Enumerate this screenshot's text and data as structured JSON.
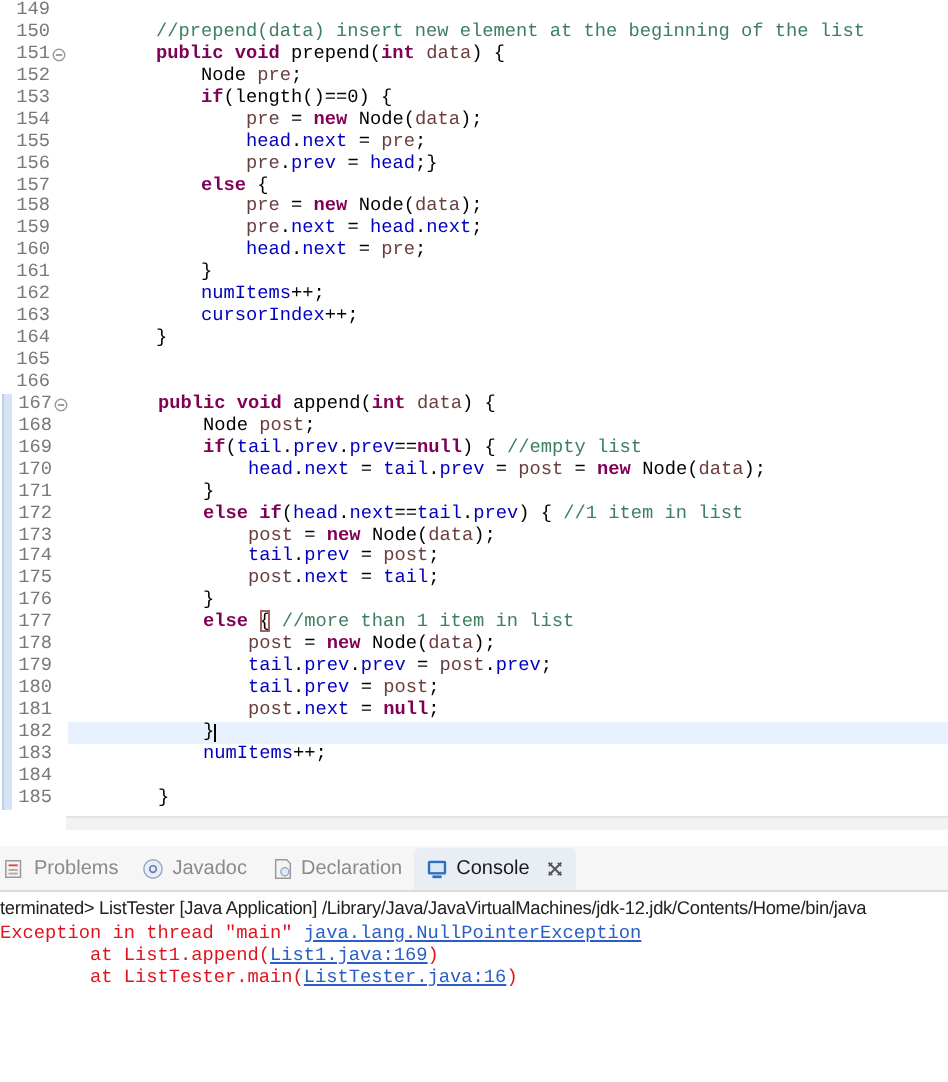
{
  "editor": {
    "lines": [
      {
        "number": "149",
        "fold": false,
        "changed": false,
        "current": false,
        "cursor": false
      },
      {
        "number": "150",
        "fold": false,
        "changed": false,
        "current": false,
        "cursor": false,
        "tokens": [
          {
            "kind": "comment",
            "text": "        //prepend(data) insert new element at the beginning of the list"
          }
        ]
      },
      {
        "number": "151",
        "fold": true,
        "changed": false,
        "current": false,
        "cursor": false,
        "tokens": [
          {
            "kind": "keyword",
            "text": "        public void "
          },
          {
            "kind": "plain",
            "text": "prepend("
          },
          {
            "kind": "keyword",
            "text": "int "
          },
          {
            "kind": "local",
            "text": "data"
          },
          {
            "kind": "plain",
            "text": ") {"
          }
        ]
      },
      {
        "number": "152",
        "fold": false,
        "changed": false,
        "current": false,
        "cursor": false,
        "tokens": [
          {
            "kind": "plain",
            "text": "            Node "
          },
          {
            "kind": "local",
            "text": "pre"
          },
          {
            "kind": "plain",
            "text": ";"
          }
        ]
      },
      {
        "number": "153",
        "fold": false,
        "changed": false,
        "current": false,
        "cursor": false,
        "tokens": [
          {
            "kind": "keyword",
            "text": "            if"
          },
          {
            "kind": "plain",
            "text": "(length()==0) {"
          }
        ]
      },
      {
        "number": "154",
        "fold": false,
        "changed": false,
        "current": false,
        "cursor": false,
        "tokens": [
          {
            "kind": "local",
            "text": "                pre"
          },
          {
            "kind": "plain",
            "text": " = "
          },
          {
            "kind": "keyword",
            "text": "new"
          },
          {
            "kind": "plain",
            "text": " Node("
          },
          {
            "kind": "local",
            "text": "data"
          },
          {
            "kind": "plain",
            "text": ");"
          }
        ]
      },
      {
        "number": "155",
        "fold": false,
        "changed": false,
        "current": false,
        "cursor": false,
        "tokens": [
          {
            "kind": "field",
            "text": "                head"
          },
          {
            "kind": "plain",
            "text": "."
          },
          {
            "kind": "field",
            "text": "next"
          },
          {
            "kind": "plain",
            "text": " = "
          },
          {
            "kind": "local",
            "text": "pre"
          },
          {
            "kind": "plain",
            "text": ";"
          }
        ]
      },
      {
        "number": "156",
        "fold": false,
        "changed": false,
        "current": false,
        "cursor": false,
        "tokens": [
          {
            "kind": "local",
            "text": "                pre"
          },
          {
            "kind": "plain",
            "text": "."
          },
          {
            "kind": "field",
            "text": "prev"
          },
          {
            "kind": "plain",
            "text": " = "
          },
          {
            "kind": "field",
            "text": "head"
          },
          {
            "kind": "plain",
            "text": ";}"
          }
        ]
      },
      {
        "number": "157",
        "fold": false,
        "changed": false,
        "current": false,
        "cursor": false,
        "tokens": [
          {
            "kind": "keyword",
            "text": "            else"
          },
          {
            "kind": "plain",
            "text": " {"
          }
        ]
      },
      {
        "number": "158",
        "fold": false,
        "changed": false,
        "current": false,
        "cursor": false,
        "tokens": [
          {
            "kind": "local",
            "text": "                pre"
          },
          {
            "kind": "plain",
            "text": " = "
          },
          {
            "kind": "keyword",
            "text": "new"
          },
          {
            "kind": "plain",
            "text": " Node("
          },
          {
            "kind": "local",
            "text": "data"
          },
          {
            "kind": "plain",
            "text": ");"
          }
        ]
      },
      {
        "number": "159",
        "fold": false,
        "changed": false,
        "current": false,
        "cursor": false,
        "tokens": [
          {
            "kind": "local",
            "text": "                pre"
          },
          {
            "kind": "plain",
            "text": "."
          },
          {
            "kind": "field",
            "text": "next"
          },
          {
            "kind": "plain",
            "text": " = "
          },
          {
            "kind": "field",
            "text": "head"
          },
          {
            "kind": "plain",
            "text": "."
          },
          {
            "kind": "field",
            "text": "next"
          },
          {
            "kind": "plain",
            "text": ";"
          }
        ]
      },
      {
        "number": "160",
        "fold": false,
        "changed": false,
        "current": false,
        "cursor": false,
        "tokens": [
          {
            "kind": "field",
            "text": "                head"
          },
          {
            "kind": "plain",
            "text": "."
          },
          {
            "kind": "field",
            "text": "next"
          },
          {
            "kind": "plain",
            "text": " = "
          },
          {
            "kind": "local",
            "text": "pre"
          },
          {
            "kind": "plain",
            "text": ";"
          }
        ]
      },
      {
        "number": "161",
        "fold": false,
        "changed": false,
        "current": false,
        "cursor": false,
        "tokens": [
          {
            "kind": "plain",
            "text": "            }"
          }
        ]
      },
      {
        "number": "162",
        "fold": false,
        "changed": false,
        "current": false,
        "cursor": false,
        "tokens": [
          {
            "kind": "field",
            "text": "            numItems"
          },
          {
            "kind": "plain",
            "text": "++;"
          }
        ]
      },
      {
        "number": "163",
        "fold": false,
        "changed": false,
        "current": false,
        "cursor": false,
        "tokens": [
          {
            "kind": "field",
            "text": "            cursorIndex"
          },
          {
            "kind": "plain",
            "text": "++;"
          }
        ]
      },
      {
        "number": "164",
        "fold": false,
        "changed": false,
        "current": false,
        "cursor": false,
        "tokens": [
          {
            "kind": "plain",
            "text": "        }"
          }
        ]
      },
      {
        "number": "165",
        "fold": false,
        "changed": false,
        "current": false,
        "cursor": false
      },
      {
        "number": "166",
        "fold": false,
        "changed": false,
        "current": false,
        "cursor": false
      },
      {
        "number": "167",
        "fold": true,
        "changed": true,
        "current": false,
        "cursor": false,
        "tokens": [
          {
            "kind": "keyword",
            "text": "        public void "
          },
          {
            "kind": "plain",
            "text": "append("
          },
          {
            "kind": "keyword",
            "text": "int "
          },
          {
            "kind": "local",
            "text": "data"
          },
          {
            "kind": "plain",
            "text": ") {"
          }
        ]
      },
      {
        "number": "168",
        "fold": false,
        "changed": true,
        "current": false,
        "cursor": false,
        "tokens": [
          {
            "kind": "plain",
            "text": "            Node "
          },
          {
            "kind": "local",
            "text": "post"
          },
          {
            "kind": "plain",
            "text": ";"
          }
        ]
      },
      {
        "number": "169",
        "fold": false,
        "changed": true,
        "current": false,
        "cursor": false,
        "tokens": [
          {
            "kind": "keyword",
            "text": "            if"
          },
          {
            "kind": "plain",
            "text": "("
          },
          {
            "kind": "field",
            "text": "tail"
          },
          {
            "kind": "plain",
            "text": "."
          },
          {
            "kind": "field",
            "text": "prev"
          },
          {
            "kind": "plain",
            "text": "."
          },
          {
            "kind": "field",
            "text": "prev"
          },
          {
            "kind": "plain",
            "text": "=="
          },
          {
            "kind": "keyword",
            "text": "null"
          },
          {
            "kind": "plain",
            "text": ") { "
          },
          {
            "kind": "comment",
            "text": "//empty list"
          }
        ]
      },
      {
        "number": "170",
        "fold": false,
        "changed": true,
        "current": false,
        "cursor": false,
        "tokens": [
          {
            "kind": "field",
            "text": "                head"
          },
          {
            "kind": "plain",
            "text": "."
          },
          {
            "kind": "field",
            "text": "next"
          },
          {
            "kind": "plain",
            "text": " = "
          },
          {
            "kind": "field",
            "text": "tail"
          },
          {
            "kind": "plain",
            "text": "."
          },
          {
            "kind": "field",
            "text": "prev"
          },
          {
            "kind": "plain",
            "text": " = "
          },
          {
            "kind": "local",
            "text": "post"
          },
          {
            "kind": "plain",
            "text": " = "
          },
          {
            "kind": "keyword",
            "text": "new"
          },
          {
            "kind": "plain",
            "text": " Node("
          },
          {
            "kind": "local",
            "text": "data"
          },
          {
            "kind": "plain",
            "text": ");"
          }
        ]
      },
      {
        "number": "171",
        "fold": false,
        "changed": true,
        "current": false,
        "cursor": false,
        "tokens": [
          {
            "kind": "plain",
            "text": "            }"
          }
        ]
      },
      {
        "number": "172",
        "fold": false,
        "changed": true,
        "current": false,
        "cursor": false,
        "tokens": [
          {
            "kind": "keyword",
            "text": "            else if"
          },
          {
            "kind": "plain",
            "text": "("
          },
          {
            "kind": "field",
            "text": "head"
          },
          {
            "kind": "plain",
            "text": "."
          },
          {
            "kind": "field",
            "text": "next"
          },
          {
            "kind": "plain",
            "text": "=="
          },
          {
            "kind": "field",
            "text": "tail"
          },
          {
            "kind": "plain",
            "text": "."
          },
          {
            "kind": "field",
            "text": "prev"
          },
          {
            "kind": "plain",
            "text": ") { "
          },
          {
            "kind": "comment",
            "text": "//1 item in list"
          }
        ]
      },
      {
        "number": "173",
        "fold": false,
        "changed": true,
        "current": false,
        "cursor": false,
        "tokens": [
          {
            "kind": "local",
            "text": "                post"
          },
          {
            "kind": "plain",
            "text": " = "
          },
          {
            "kind": "keyword",
            "text": "new"
          },
          {
            "kind": "plain",
            "text": " Node("
          },
          {
            "kind": "local",
            "text": "data"
          },
          {
            "kind": "plain",
            "text": ");"
          }
        ]
      },
      {
        "number": "174",
        "fold": false,
        "changed": true,
        "current": false,
        "cursor": false,
        "tokens": [
          {
            "kind": "field",
            "text": "                tail"
          },
          {
            "kind": "plain",
            "text": "."
          },
          {
            "kind": "field",
            "text": "prev"
          },
          {
            "kind": "plain",
            "text": " = "
          },
          {
            "kind": "local",
            "text": "post"
          },
          {
            "kind": "plain",
            "text": ";"
          }
        ]
      },
      {
        "number": "175",
        "fold": false,
        "changed": true,
        "current": false,
        "cursor": false,
        "tokens": [
          {
            "kind": "local",
            "text": "                post"
          },
          {
            "kind": "plain",
            "text": "."
          },
          {
            "kind": "field",
            "text": "next"
          },
          {
            "kind": "plain",
            "text": " = "
          },
          {
            "kind": "field",
            "text": "tail"
          },
          {
            "kind": "plain",
            "text": ";"
          }
        ]
      },
      {
        "number": "176",
        "fold": false,
        "changed": true,
        "current": false,
        "cursor": false,
        "tokens": [
          {
            "kind": "plain",
            "text": "            }"
          }
        ]
      },
      {
        "number": "177",
        "fold": false,
        "changed": true,
        "current": false,
        "cursor": false,
        "tokens": [
          {
            "kind": "keyword",
            "text": "            else "
          },
          {
            "kind": "matched_bracket",
            "text": "{"
          },
          {
            "kind": "comment",
            "text": " //more than 1 item in list"
          }
        ]
      },
      {
        "number": "178",
        "fold": false,
        "changed": true,
        "current": false,
        "cursor": false,
        "tokens": [
          {
            "kind": "local",
            "text": "                post"
          },
          {
            "kind": "plain",
            "text": " = "
          },
          {
            "kind": "keyword",
            "text": "new"
          },
          {
            "kind": "plain",
            "text": " Node("
          },
          {
            "kind": "local",
            "text": "data"
          },
          {
            "kind": "plain",
            "text": ");"
          }
        ]
      },
      {
        "number": "179",
        "fold": false,
        "changed": true,
        "current": false,
        "cursor": false,
        "tokens": [
          {
            "kind": "field",
            "text": "                tail"
          },
          {
            "kind": "plain",
            "text": "."
          },
          {
            "kind": "field",
            "text": "prev"
          },
          {
            "kind": "plain",
            "text": "."
          },
          {
            "kind": "field",
            "text": "prev"
          },
          {
            "kind": "plain",
            "text": " = "
          },
          {
            "kind": "local",
            "text": "post"
          },
          {
            "kind": "plain",
            "text": "."
          },
          {
            "kind": "field",
            "text": "prev"
          },
          {
            "kind": "plain",
            "text": ";"
          }
        ]
      },
      {
        "number": "180",
        "fold": false,
        "changed": true,
        "current": false,
        "cursor": false,
        "tokens": [
          {
            "kind": "field",
            "text": "                tail"
          },
          {
            "kind": "plain",
            "text": "."
          },
          {
            "kind": "field",
            "text": "prev"
          },
          {
            "kind": "plain",
            "text": " = "
          },
          {
            "kind": "local",
            "text": "post"
          },
          {
            "kind": "plain",
            "text": ";"
          }
        ]
      },
      {
        "number": "181",
        "fold": false,
        "changed": true,
        "current": false,
        "cursor": false,
        "tokens": [
          {
            "kind": "local",
            "text": "                post"
          },
          {
            "kind": "plain",
            "text": "."
          },
          {
            "kind": "field",
            "text": "next"
          },
          {
            "kind": "plain",
            "text": " = "
          },
          {
            "kind": "keyword",
            "text": "null"
          },
          {
            "kind": "plain",
            "text": ";"
          }
        ]
      },
      {
        "number": "182",
        "fold": false,
        "changed": true,
        "current": true,
        "cursor": true,
        "tokens": [
          {
            "kind": "plain",
            "text": "            }"
          }
        ]
      },
      {
        "number": "183",
        "fold": false,
        "changed": true,
        "current": false,
        "cursor": false,
        "tokens": [
          {
            "kind": "field",
            "text": "            numItems"
          },
          {
            "kind": "plain",
            "text": "++;"
          }
        ]
      },
      {
        "number": "184",
        "fold": false,
        "changed": true,
        "current": false,
        "cursor": false
      },
      {
        "number": "185",
        "fold": false,
        "changed": true,
        "current": false,
        "cursor": false,
        "tokens": [
          {
            "kind": "plain",
            "text": "        }"
          }
        ]
      }
    ]
  },
  "panel": {
    "tabs": [
      {
        "kind": "problems",
        "label": "Problems",
        "selected": false
      },
      {
        "kind": "javadoc",
        "label": "Javadoc",
        "selected": false
      },
      {
        "kind": "declaration",
        "label": "Declaration",
        "selected": false
      },
      {
        "kind": "console",
        "label": "Console",
        "selected": true
      }
    ],
    "console": {
      "header": "terminated> ListTester [Java Application] /Library/Java/JavaVirtualMachines/jdk-12.jdk/Contents/Home/bin/java",
      "lines": [
        {
          "tokens": [
            {
              "kind": "error",
              "text": "Exception in thread \"main\" "
            },
            {
              "kind": "link",
              "text": "java.lang.NullPointerException"
            }
          ]
        },
        {
          "tokens": [
            {
              "kind": "error",
              "text": "        at List1.append("
            },
            {
              "kind": "link",
              "text": "List1.java:169"
            },
            {
              "kind": "error",
              "text": ")"
            }
          ]
        },
        {
          "tokens": [
            {
              "kind": "error",
              "text": "        at ListTester.main("
            },
            {
              "kind": "link",
              "text": "ListTester.java:16"
            },
            {
              "kind": "error",
              "text": ")"
            }
          ]
        }
      ]
    }
  }
}
